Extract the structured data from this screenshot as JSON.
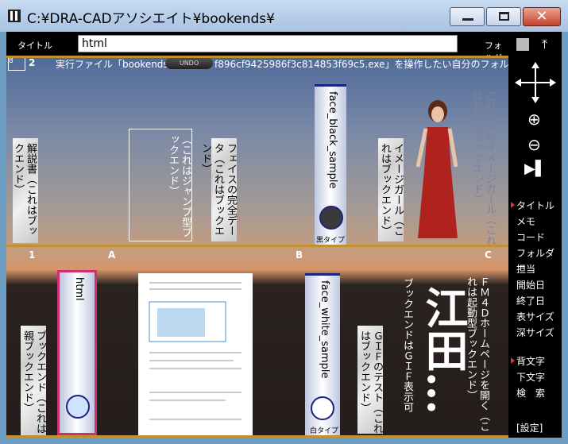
{
  "window": {
    "title": "C:¥DRA-CADアソシエイト¥bookends¥",
    "close_glyph": "✕"
  },
  "toolbar": {
    "title_label": "タイトル",
    "title_value": "html",
    "folder_label": "フォルダ"
  },
  "status": {
    "counter": "8",
    "index": "2",
    "message": "実行ファイル「bookends",
    "message_tail": "f896cf9425986f3c814853f69c5.exe」を操作したい自分のフォルダ",
    "undo_label": "UNDO"
  },
  "shelf_top": {
    "books": [
      {
        "title": "解説書",
        "subtitle": "（これはブックエンド）"
      },
      {
        "title": "（これはジャンプ型ブックエンド）"
      },
      {
        "title": "フェイスの完全データ",
        "subtitle": "（これはブックエンド）"
      },
      {
        "title": "face_black_sample",
        "caption": "黒タイプ"
      },
      {
        "title": "イメージガール",
        "subtitle": "（これはブックエンド）"
      },
      {
        "title": "これは誰のイメージガール",
        "subtitle": "（これは起動型ブックエンド）"
      }
    ],
    "row_labels": [
      "1",
      "A",
      "B",
      "C"
    ]
  },
  "shelf_bottom": {
    "books": [
      {
        "title": "ブックエンド",
        "subtitle": "（これは親ブックエンド）"
      },
      {
        "title": "html"
      },
      {
        "title": "face_white_sample",
        "caption": "白タイプ"
      },
      {
        "title": "ＧＩＦのテスト",
        "subtitle": "（これはブックエンド）"
      },
      {
        "title": "ブックエンドはＧＩＦ表示可"
      },
      {
        "title": "ＦＭ４Ｄホームページを開く",
        "subtitle": "（これは起動型ブックエンド）"
      }
    ],
    "calligraphy": "江田…"
  },
  "sidebar": {
    "menu": [
      "タイトル",
      "メモ",
      "コード",
      "フォルダー",
      "担当",
      "開始日",
      "終了日",
      "表サイズ",
      "深サイズ"
    ],
    "menu2": [
      "背文字",
      "下文字",
      "検　索"
    ],
    "settings": "[設定]"
  },
  "colors": {
    "accent_gold": "#c2902e",
    "spine_navy": "#1a237e",
    "spine_pink": "#d0306f"
  }
}
